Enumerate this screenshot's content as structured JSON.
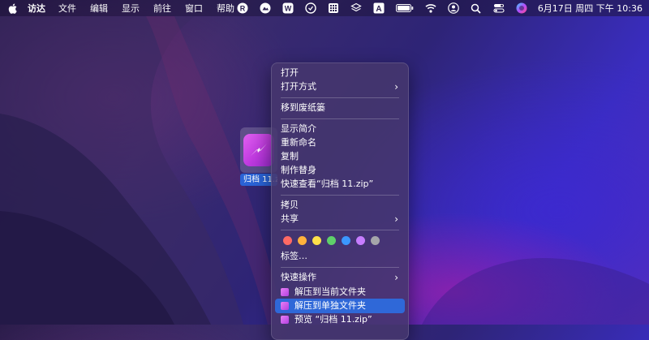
{
  "menubar": {
    "app_name": "访达",
    "items": [
      "文件",
      "编辑",
      "显示",
      "前往",
      "窗口",
      "帮助"
    ],
    "status_icons": [
      "r-app-icon",
      "cloud-app-icon",
      "w-app-icon",
      "grammar-icon",
      "grid-icon",
      "layers-icon",
      "a-text-icon",
      "battery-icon",
      "wifi-icon",
      "user-icon",
      "search-icon",
      "control-center-icon",
      "siri-icon"
    ],
    "clock": "6月17日 周四 下午 10:36"
  },
  "file": {
    "label": "归档 11.zip",
    "icon": "archive-app-icon"
  },
  "context_menu": {
    "open": "打开",
    "open_with": "打开方式",
    "move_to_trash": "移到废纸篓",
    "get_info": "显示简介",
    "rename": "重新命名",
    "duplicate": "复制",
    "make_alias": "制作替身",
    "quick_look": "快速查看“归档 11.zip”",
    "copy": "拷贝",
    "share": "共享",
    "tags": "标签…",
    "tag_colors": [
      "#ff6a64",
      "#ffb23c",
      "#ffe04a",
      "#5fd06a",
      "#3b97ff",
      "#c77dff",
      "#a5a5aa"
    ],
    "quick_actions": "快速操作",
    "extract_here": "解压到当前文件夹",
    "extract_folder": "解压到单独文件夹",
    "preview": "预览 “归档 11.zip”"
  }
}
